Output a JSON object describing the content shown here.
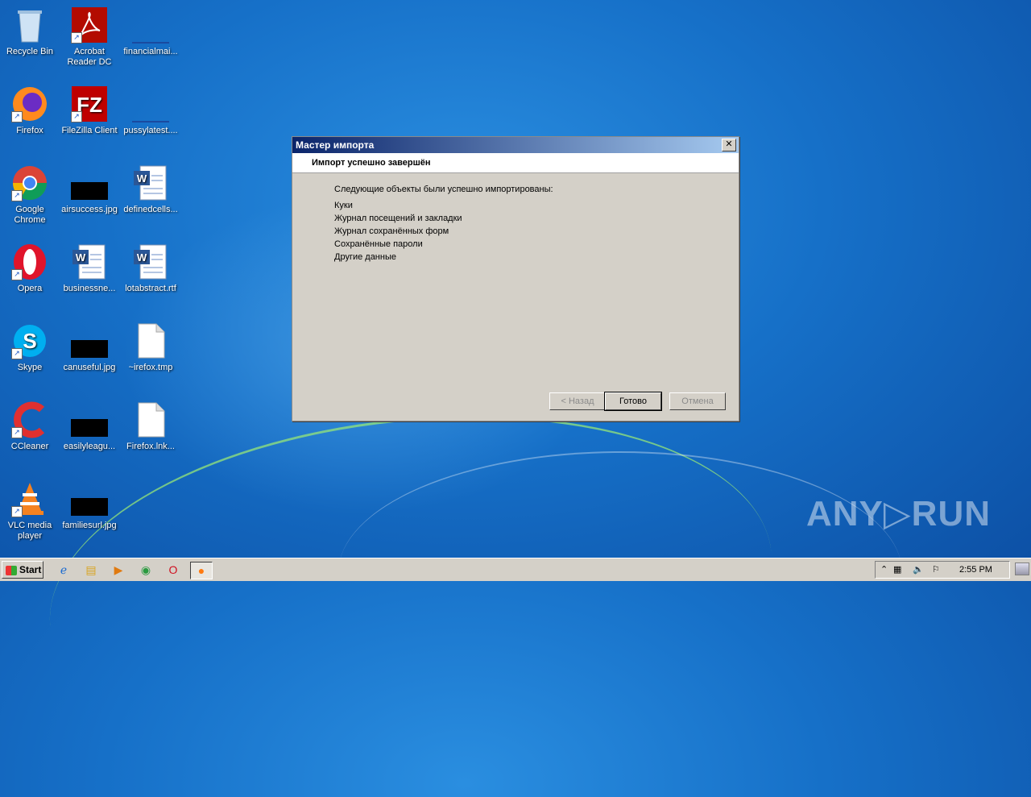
{
  "desktop": {
    "icons": [
      {
        "label": "Recycle Bin",
        "icon": "recycle-bin-icon"
      },
      {
        "label": "Acrobat Reader DC",
        "icon": "acrobat-icon"
      },
      {
        "label": "financialmai...",
        "icon": "file-icon"
      },
      {
        "label": "Firefox",
        "icon": "firefox-icon"
      },
      {
        "label": "FileZilla Client",
        "icon": "filezilla-icon"
      },
      {
        "label": "pussylatest....",
        "icon": "file-icon"
      },
      {
        "label": "Google Chrome",
        "icon": "chrome-icon"
      },
      {
        "label": "airsuccess.jpg",
        "icon": "image-icon"
      },
      {
        "label": "definedcells...",
        "icon": "word-doc-icon"
      },
      {
        "label": "Opera",
        "icon": "opera-icon"
      },
      {
        "label": "businessne...",
        "icon": "word-doc-icon"
      },
      {
        "label": "lotabstract.rtf",
        "icon": "word-doc-icon"
      },
      {
        "label": "Skype",
        "icon": "skype-icon"
      },
      {
        "label": "canuseful.jpg",
        "icon": "image-icon"
      },
      {
        "label": "~irefox.tmp",
        "icon": "blank-file-icon"
      },
      {
        "label": "CCleaner",
        "icon": "ccleaner-icon"
      },
      {
        "label": "easilyleagu...",
        "icon": "image-icon"
      },
      {
        "label": "Firefox.lnk...",
        "icon": "blank-file-icon"
      },
      {
        "label": "VLC media player",
        "icon": "vlc-icon"
      },
      {
        "label": "familiesurl.jpg",
        "icon": "image-icon"
      }
    ]
  },
  "dialog": {
    "title": "Мастер импорта",
    "header": "Импорт успешно завершён",
    "intro": "Следующие объекты были успешно импортированы:",
    "items": [
      "Куки",
      "Журнал посещений и закладки",
      "Журнал сохранённых форм",
      "Сохранённые пароли",
      "Другие данные"
    ],
    "buttons": {
      "back": "< Назад",
      "finish": "Готово",
      "cancel": "Отмена"
    }
  },
  "taskbar": {
    "start_label": "Start",
    "clock": "2:55 PM"
  },
  "watermark": "ANY▷RUN"
}
